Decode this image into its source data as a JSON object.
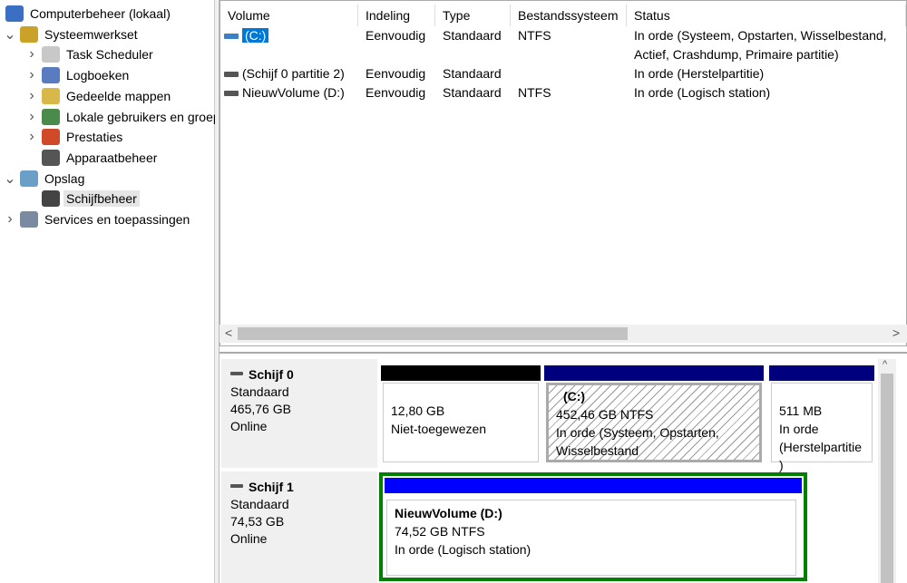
{
  "tree": [
    {
      "label": "Computerbeheer (lokaal)",
      "icon": "computer-management-icon",
      "level": 0,
      "chev": ""
    },
    {
      "label": "Systeemwerkset",
      "icon": "tools-icon",
      "level": 1,
      "chev": "v"
    },
    {
      "label": "Task Scheduler",
      "icon": "clock-icon",
      "level": 2,
      "chev": ">"
    },
    {
      "label": "Logboeken",
      "icon": "event-log-icon",
      "level": 2,
      "chev": ">"
    },
    {
      "label": "Gedeelde mappen",
      "icon": "shared-folder-icon",
      "level": 2,
      "chev": ">"
    },
    {
      "label": "Lokale gebruikers en groepen",
      "icon": "users-icon",
      "level": 2,
      "chev": ">"
    },
    {
      "label": "Prestaties",
      "icon": "performance-icon",
      "level": 2,
      "chev": ">"
    },
    {
      "label": "Apparaatbeheer",
      "icon": "device-manager-icon",
      "level": 2,
      "chev": ""
    },
    {
      "label": "Opslag",
      "icon": "storage-icon",
      "level": 1,
      "chev": "v"
    },
    {
      "label": "Schijfbeheer",
      "icon": "disk-management-icon",
      "level": 2,
      "chev": ""
    },
    {
      "label": "Services en toepassingen",
      "icon": "services-icon",
      "level": 1,
      "chev": ">"
    }
  ],
  "columns": [
    "Volume",
    "Indeling",
    "Type",
    "Bestandssysteem",
    "Status"
  ],
  "rows": [
    [
      "(C:)",
      "Eenvoudig",
      "Standaard",
      "NTFS",
      "In orde (Systeem, Opstarten, Wisselbestand, Actief, Crashdump, Primaire partitie)"
    ],
    [
      "(Schijf 0 partitie 2)",
      "Eenvoudig",
      "Standaard",
      "",
      "In orde (Herstelpartitie)"
    ],
    [
      "NieuwVolume (D:)",
      "Eenvoudig",
      "Standaard",
      "NTFS",
      "In orde (Logisch station)"
    ]
  ],
  "scroll": {
    "left": "<",
    "right": ">",
    "up": "^"
  },
  "disks": [
    {
      "name": "Schijf 0",
      "type": "Standaard",
      "size": "465,76 GB",
      "status": "Online",
      "partitions": [
        {
          "title": "",
          "size": "12,80 GB",
          "status": "Niet-toegewezen"
        },
        {
          "title": "(C:)",
          "size": "452,46 GB NTFS",
          "status": "In orde (Systeem, Opstarten, Wisselbestand"
        },
        {
          "title": "",
          "size": "511 MB",
          "status": "In orde (Herstelpartitie)"
        }
      ]
    },
    {
      "name": "Schijf 1",
      "type": "Standaard",
      "size": "74,53 GB",
      "status": "Online",
      "partitions": [
        {
          "title": "NieuwVolume  (D:)",
          "size": "74,52 GB NTFS",
          "status": "In orde (Logisch station)"
        }
      ]
    }
  ],
  "colors": {
    "unallocated": "#000000",
    "primary": "#00007f",
    "logical": "#0000ff",
    "selected": "#008000"
  }
}
